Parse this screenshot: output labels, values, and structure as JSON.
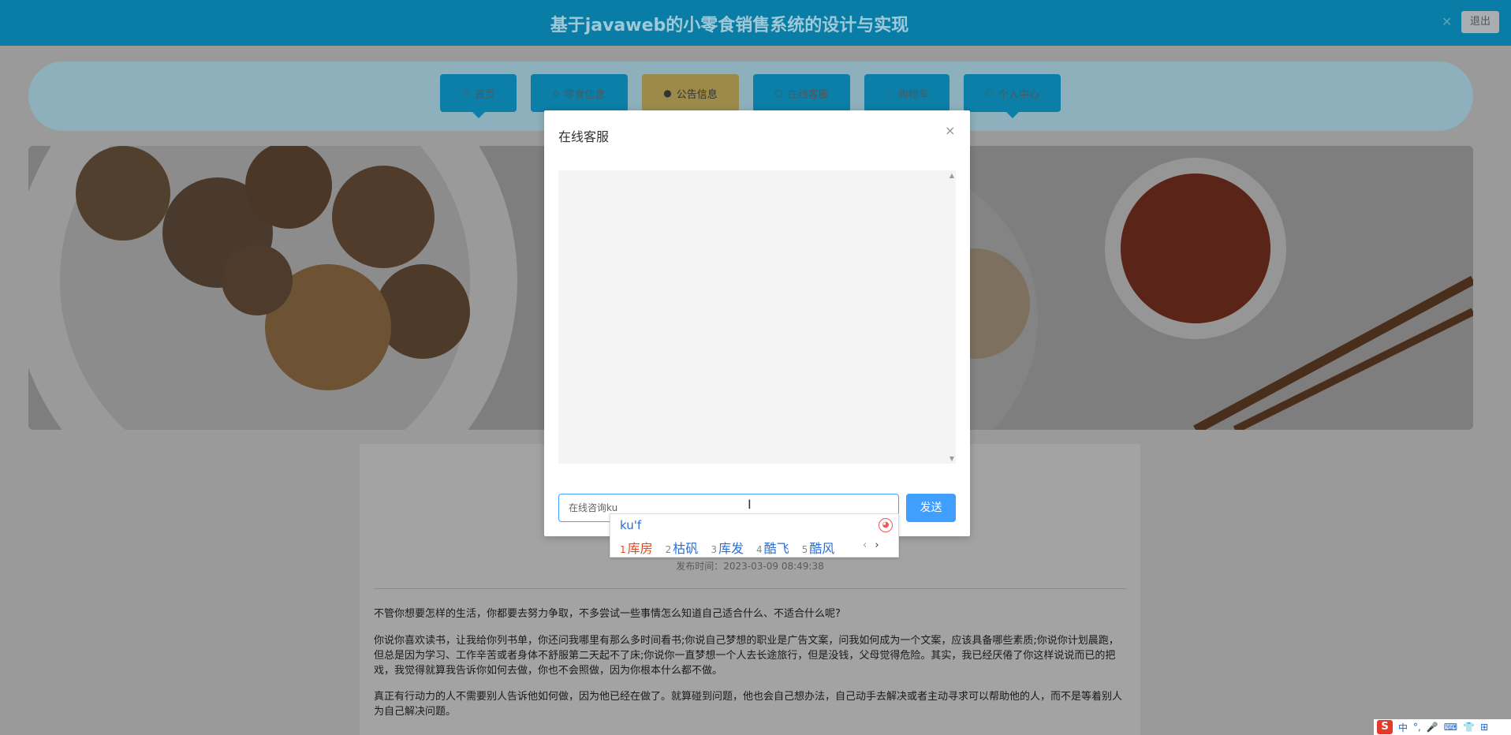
{
  "header": {
    "title": "基于javaweb的小零食销售系统的设计与实现",
    "logout_label": "退出"
  },
  "nav": {
    "items": [
      {
        "label": "首页",
        "icon": "star-icon"
      },
      {
        "label": "零食信息",
        "icon": "bag-icon"
      },
      {
        "label": "公告信息",
        "icon": "alert-icon"
      },
      {
        "label": "在线客服",
        "icon": "headset-icon"
      },
      {
        "label": "购物车",
        "icon": "heart-icon"
      },
      {
        "label": "个人中心",
        "icon": "user-icon"
      }
    ],
    "active": "公告信息"
  },
  "article": {
    "pubtime": "发布时间：2023-03-09 08:49:38",
    "paragraphs": [
      "不管你想要怎样的生活，你都要去努力争取，不多尝试一些事情怎么知道自己适合什么、不适合什么呢?",
      "你说你喜欢读书，让我给你列书单，你还问我哪里有那么多时间看书;你说自己梦想的职业是广告文案，问我如何成为一个文案，应该具备哪些素质;你说你计划晨跑，但总是因为学习、工作辛苦或者身体不舒服第二天起不了床;你说你一直梦想一个人去长途旅行，但是没钱，父母觉得危险。其实，我已经厌倦了你这样说说而已的把戏，我觉得就算我告诉你如何去做，你也不会照做，因为你根本什么都不做。",
      "真正有行动力的人不需要别人告诉他如何做，因为他已经在做了。就算碰到问题，他也会自己想办法，自己动手去解决或者主动寻求可以帮助他的人，而不是等着别人为自己解决问题。"
    ]
  },
  "modal": {
    "title": "在线客服",
    "close": "×",
    "input_text": "在线咨询ku",
    "input_cursor": "I",
    "send_label": "发送"
  },
  "ime": {
    "pinyin": "ku'f",
    "candidates": [
      {
        "num": "1",
        "word": "库房"
      },
      {
        "num": "2",
        "word": "枯矾"
      },
      {
        "num": "3",
        "word": "库发"
      },
      {
        "num": "4",
        "word": "酷飞"
      },
      {
        "num": "5",
        "word": "酷风"
      }
    ],
    "next": "›",
    "prev": "‹"
  },
  "tray": {
    "items": [
      "中",
      "°,",
      "🎤",
      "⌨",
      "👕",
      "⊞"
    ]
  },
  "colors": {
    "header": "#0a7da6",
    "accent": "#409eff",
    "ime_first": "#e6491b"
  }
}
